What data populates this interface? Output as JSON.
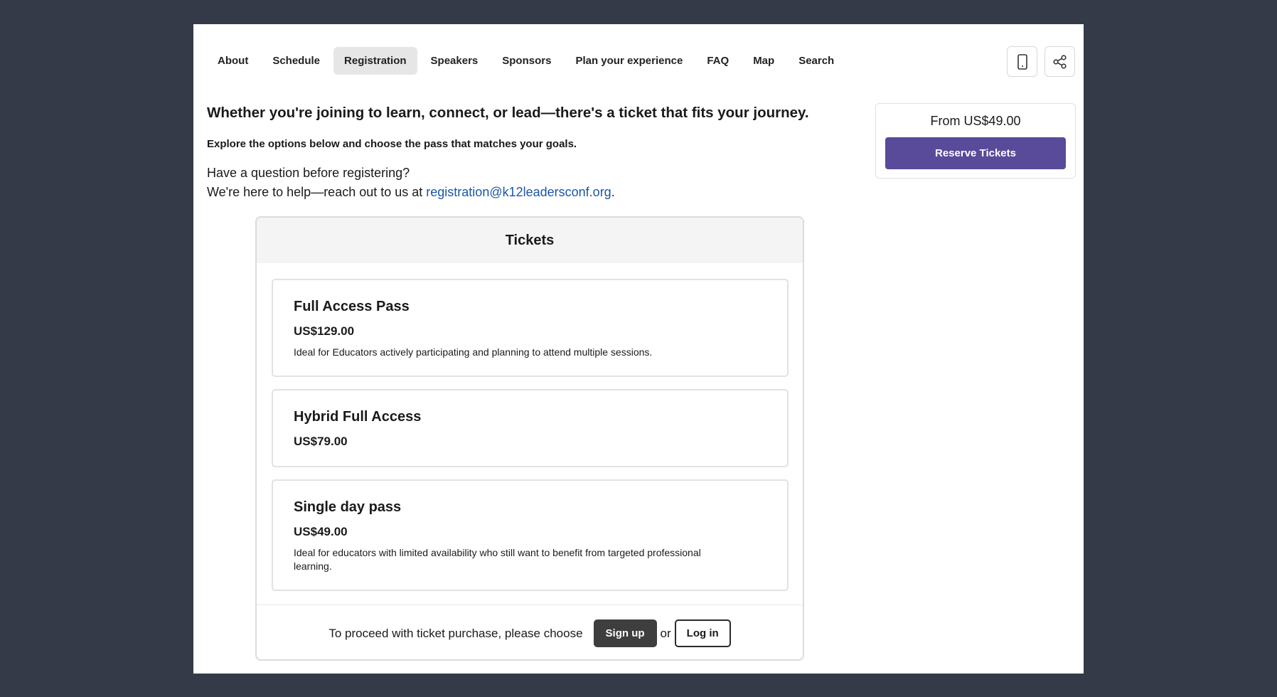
{
  "nav": {
    "items": [
      {
        "label": "About"
      },
      {
        "label": "Schedule"
      },
      {
        "label": "Registration"
      },
      {
        "label": "Speakers"
      },
      {
        "label": "Sponsors"
      },
      {
        "label": "Plan your experience"
      },
      {
        "label": "FAQ"
      },
      {
        "label": "Map"
      },
      {
        "label": "Search"
      }
    ],
    "active": "Registration",
    "icons": [
      "mobile-icon",
      "share-icon"
    ]
  },
  "intro": {
    "headline": "Whether you're joining to learn, connect, or lead—there's a ticket that fits your journey.",
    "subline": "Explore the options below and choose the pass that matches your goals.",
    "question_line": "Have a question before registering?",
    "help_prefix": "We're here to help—reach out to us at ",
    "email": "registration@k12leadersconf.org",
    "help_suffix": "."
  },
  "side_card": {
    "price": "From US$49.00",
    "button_label": "Reserve Tickets",
    "button_color": "#5a4a9a"
  },
  "tickets": {
    "title": "Tickets",
    "items": [
      {
        "name": "Full Access Pass",
        "price": "US$129.00",
        "description": "Ideal for Educators actively participating and planning to attend multiple sessions."
      },
      {
        "name": "Hybrid Full Access",
        "price": "US$79.00",
        "description": ""
      },
      {
        "name": "Single day pass",
        "price": "US$49.00",
        "description": "Ideal for educators with limited availability who still want to benefit from targeted professional learning."
      }
    ],
    "footer": {
      "prompt": "To proceed with ticket purchase, please choose",
      "signup_label": "Sign up",
      "or_label": "or",
      "login_label": "Log in"
    }
  }
}
